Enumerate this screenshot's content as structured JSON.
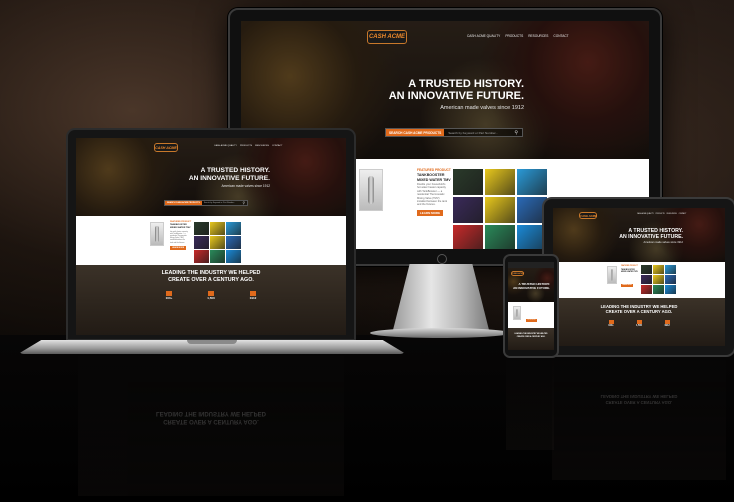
{
  "brand": {
    "logo_text": "CASH ACME",
    "accent": "#e06a1c"
  },
  "nav": [
    "CASH ACME QUALITY",
    "PRODUCTS",
    "RESOURCES",
    "CONTACT"
  ],
  "hero": {
    "title_line1": "A TRUSTED HISTORY.",
    "title_line2": "AN INNOVATIVE FUTURE.",
    "subtitle": "American made valves since 1912"
  },
  "search": {
    "label": "SEARCH CASH ACME PRODUCTS",
    "placeholder": "Search by Keyword or Part Number..."
  },
  "feature": {
    "kicker": "FEATURED PRODUCT",
    "title_line1": "TANKBOOSTER",
    "title_line2": "MIXED WATER TMV",
    "body": "Double your household's hot water heater capacity with TankBooster — a residential Thermostatic Mixing Valve (TMV) installed between the tank and the fixtures.",
    "button": "LEARN MORE"
  },
  "tile_colors": [
    "#2a3a2a",
    "#e8c81c",
    "#2a9ad8",
    "#3a2a5a",
    "#e8c81c",
    "#2a6ab8",
    "#c82a2a",
    "#2a8a5a",
    "#1a8ad8"
  ],
  "leading": {
    "line1": "LEADING THE INDUSTRY WE HELPED",
    "line2": "CREATE OVER A CENTURY AGO."
  },
  "stats": [
    "100+",
    "1,500",
    "1912"
  ],
  "reflection": {
    "line1": "CREATE OVER A CENTURY AGO.",
    "line2": "LEADING THE INDUSTRY WE HELPED"
  }
}
